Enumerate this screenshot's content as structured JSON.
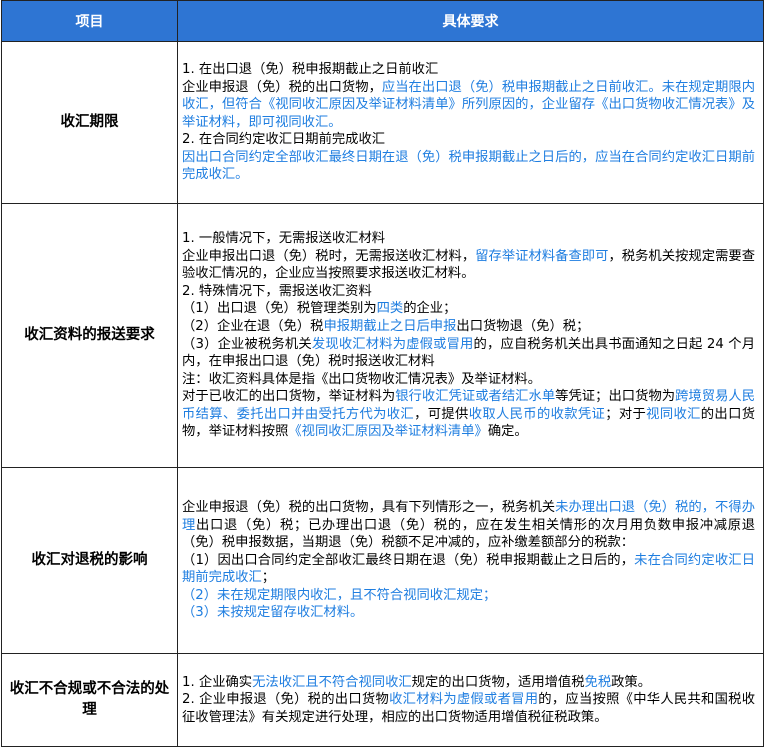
{
  "header": {
    "col_item": "项目",
    "col_req": "具体要求"
  },
  "rows": [
    {
      "item": "收汇期限",
      "lines": [
        [
          {
            "t": "1. 在出口退（免）税申报期截止之日前收汇"
          }
        ],
        [
          {
            "t": "企业申报退（免）税的出口货物，"
          },
          {
            "t": "应当在出口退（免）税申报期截止之日前收汇。未在规定期限内收汇，但符合《视同收汇原因及举证材料清单》所列原因的，企业留存《出口货物收汇情况表》及举证材料，即可视同收汇。",
            "hl": true
          }
        ],
        [
          {
            "t": "2. 在合同约定收汇日期前完成收汇"
          }
        ],
        [
          {
            "t": "因出口合同约定全部收汇最终日期在退（免）税申报期截止之日后的，应当在合同约定收汇日期前完成收汇。",
            "hl": true
          }
        ]
      ]
    },
    {
      "item": "收汇资料的报送要求",
      "lines": [
        [
          {
            "t": "1. 一般情况下，无需报送收汇材料"
          }
        ],
        [
          {
            "t": "企业申报出口退（免）税时，无需报送收汇材料，"
          },
          {
            "t": "留存举证材料备查即可",
            "hl": true
          },
          {
            "t": "，税务机关按规定需要查验收汇情况的，企业应当按照要求报送收汇材料。"
          }
        ],
        [
          {
            "t": "2. 特殊情况下，需报送收汇资料"
          }
        ],
        [
          {
            "t": "（1）出口退（免）税管理类别为"
          },
          {
            "t": "四类",
            "hl": true
          },
          {
            "t": "的企业；"
          }
        ],
        [
          {
            "t": "（2）企业在退（免）税"
          },
          {
            "t": "申报期截止之日后申报",
            "hl": true
          },
          {
            "t": "出口货物退（免）税；"
          }
        ],
        [
          {
            "t": "（3）企业被税务机关"
          },
          {
            "t": "发现收汇材料为虚假或冒用",
            "hl": true
          },
          {
            "t": "的，应自税务机关出具书面通知之日起 24 个月内，在申报出口退（免）税时报送收汇材料"
          }
        ],
        [
          {
            "t": "注：收汇资料具体是指《出口货物收汇情况表》及举证材料。"
          }
        ],
        [
          {
            "t": "对于已收汇的出口货物，举证材料为"
          },
          {
            "t": "银行收汇凭证或者结汇水单",
            "hl": true
          },
          {
            "t": "等凭证；出口货物为"
          },
          {
            "t": "跨境贸易人民币结算、委托出口并由受托方代为收汇",
            "hl": true
          },
          {
            "t": "，可提供"
          },
          {
            "t": "收取人民币的收款凭证",
            "hl": true
          },
          {
            "t": "；对于"
          },
          {
            "t": "视同收汇",
            "hl": true
          },
          {
            "t": "的出口货物，举证材料按照"
          },
          {
            "t": "《视同收汇原因及举证材料清单》",
            "hl": true
          },
          {
            "t": "确定。"
          }
        ]
      ]
    },
    {
      "item": "收汇对退税的影响",
      "lines": [
        [
          {
            "t": "企业申报退（免）税的出口货物，具有下列情形之一，税务机关"
          },
          {
            "t": "未办理出口退（免）税的，不得办理",
            "hl": true
          },
          {
            "t": "出口退（免）税；已办理出口退（免）税的，应在发生相关情形的次月用负数申报冲减原退（免）税申报数据，当期退（免）税额不足冲减的，应补缴差额部分的税款："
          }
        ],
        [
          {
            "t": "（1）因出口合同约定全部收汇最终日期在退（免）税申报期截止之日后的，"
          },
          {
            "t": "未在合同约定收汇日期前完成收汇",
            "hl": true
          },
          {
            "t": "；"
          }
        ],
        [
          {
            "t": "（2）未在规定期限内收汇，且不符合视同收汇规定；",
            "hl": true
          }
        ],
        [
          {
            "t": "（3）未按规定留存收汇材料。",
            "hl": true
          }
        ]
      ]
    },
    {
      "item": "收汇不合规或不合法的处理",
      "lines": [
        [
          {
            "t": "1. 企业确实"
          },
          {
            "t": "无法收汇且不符合视同收汇",
            "hl": true
          },
          {
            "t": "规定的出口货物，适用增值税"
          },
          {
            "t": "免税",
            "hl": true
          },
          {
            "t": "政策。"
          }
        ],
        [
          {
            "t": "2. 企业申报退（免）税的出口货物"
          },
          {
            "t": "收汇材料为虚假或者冒用",
            "hl": true
          },
          {
            "t": "的，应当按照《中华人民共和国税收征收管理法》有关规定进行处理，相应的出口货物适用增值税征税政策。"
          }
        ]
      ]
    }
  ],
  "colors": {
    "header_bg": "#2e75d3",
    "header_text": "#ffffff",
    "highlight": "#1f7ee0",
    "border": "#222222"
  }
}
